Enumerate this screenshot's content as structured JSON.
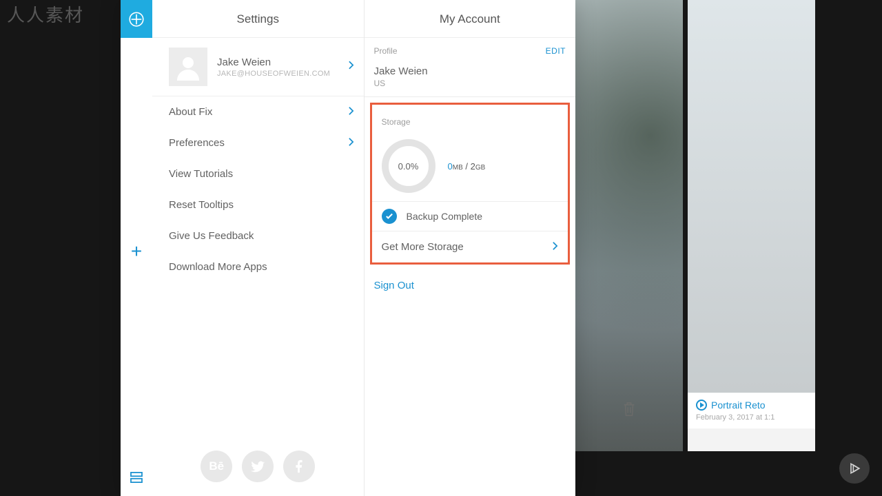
{
  "watermark": "人人素材",
  "settings": {
    "title": "Settings",
    "user": {
      "name": "Jake Weien",
      "email": "JAKE@HOUSEOFWEIEN.COM"
    },
    "items": {
      "about": "About Fix",
      "preferences": "Preferences",
      "tutorials": "View Tutorials",
      "reset_tooltips": "Reset Tooltips",
      "feedback": "Give Us Feedback",
      "download": "Download More Apps"
    },
    "social": {
      "behance": "Bē"
    }
  },
  "account": {
    "title": "My Account",
    "profile_label": "Profile",
    "edit": "EDIT",
    "profile_name": "Jake Weien",
    "profile_country": "US",
    "storage_label": "Storage",
    "storage_pct": "0.0%",
    "storage_used": "0",
    "storage_used_unit": "MB",
    "storage_sep": " / ",
    "storage_total": "2",
    "storage_total_unit": "GB",
    "backup": "Backup Complete",
    "get_more": "Get More Storage",
    "signout": "Sign Out"
  },
  "card": {
    "title": "Portrait Reto",
    "date": "February 3, 2017 at 1:1"
  }
}
